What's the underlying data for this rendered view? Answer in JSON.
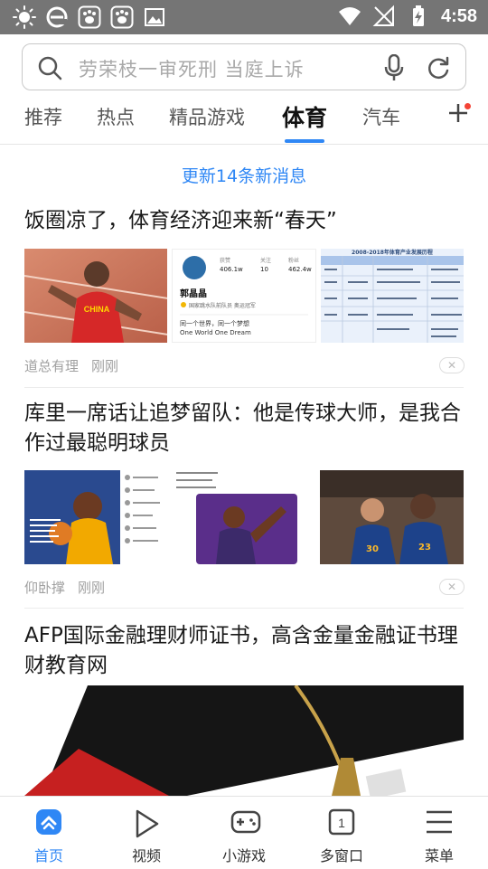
{
  "status_bar": {
    "time": "4:58",
    "left_icons": [
      "sun-icon",
      "ie-browser-icon",
      "baidu-paw-icon",
      "baidu-paw-icon",
      "gallery-icon"
    ],
    "right_icons": [
      "wifi-icon",
      "no-signal-icon",
      "battery-charging-icon"
    ]
  },
  "search": {
    "placeholder": "劳荣枝一审死刑 当庭上诉"
  },
  "tabs": [
    {
      "label": "推荐",
      "active": false
    },
    {
      "label": "热点",
      "active": false
    },
    {
      "label": "精品游戏",
      "active": false
    },
    {
      "label": "体育",
      "active": true
    },
    {
      "label": "汽车",
      "active": false
    }
  ],
  "feed": {
    "update_message": "更新14条新消息",
    "articles": [
      {
        "title": "饭圈凉了，体育经济迎来新“春天”",
        "source": "道总有理",
        "time": "刚刚",
        "thumbs": [
          {
            "kind": "athlete",
            "jersey": "CHINA"
          },
          {
            "kind": "profile",
            "name": "郭晶晶",
            "stats": [
              {
                "label": "获赞",
                "value": "406.1w"
              },
              {
                "label": "关注",
                "value": "10"
              },
              {
                "label": "粉丝",
                "value": "462.4w"
              }
            ],
            "bio": "国家跳水队前队员 奥运冠军",
            "motto": "同一个世界，同一个梦想",
            "motto_en": "One World One Dream"
          },
          {
            "kind": "table",
            "heading": "2008-2018年体育产业发展历程"
          }
        ]
      },
      {
        "title": "库里一席话让追梦留队：他是传球大师，是我合作过最聪明球员",
        "source": "仰卧撑",
        "time": "刚刚",
        "thumbs": [
          {
            "kind": "social"
          },
          {
            "kind": "player-list"
          },
          {
            "kind": "two-players",
            "numbers": [
              "30",
              "23"
            ]
          }
        ]
      },
      {
        "title": "AFP国际金融理财师证书，高含金量金融证书理财教育网"
      }
    ]
  },
  "bottom_nav": [
    {
      "label": "首页",
      "icon": "home-icon",
      "active": true
    },
    {
      "label": "视频",
      "icon": "play-icon",
      "active": false
    },
    {
      "label": "小游戏",
      "icon": "gamepad-icon",
      "active": false
    },
    {
      "label": "多窗口",
      "icon": "windows-icon",
      "active": false,
      "count": "1"
    },
    {
      "label": "菜单",
      "icon": "menu-icon",
      "active": false
    }
  ],
  "colors": {
    "accent": "#2f87f5",
    "status_bar": "#757575",
    "notification_dot": "#f44336"
  }
}
